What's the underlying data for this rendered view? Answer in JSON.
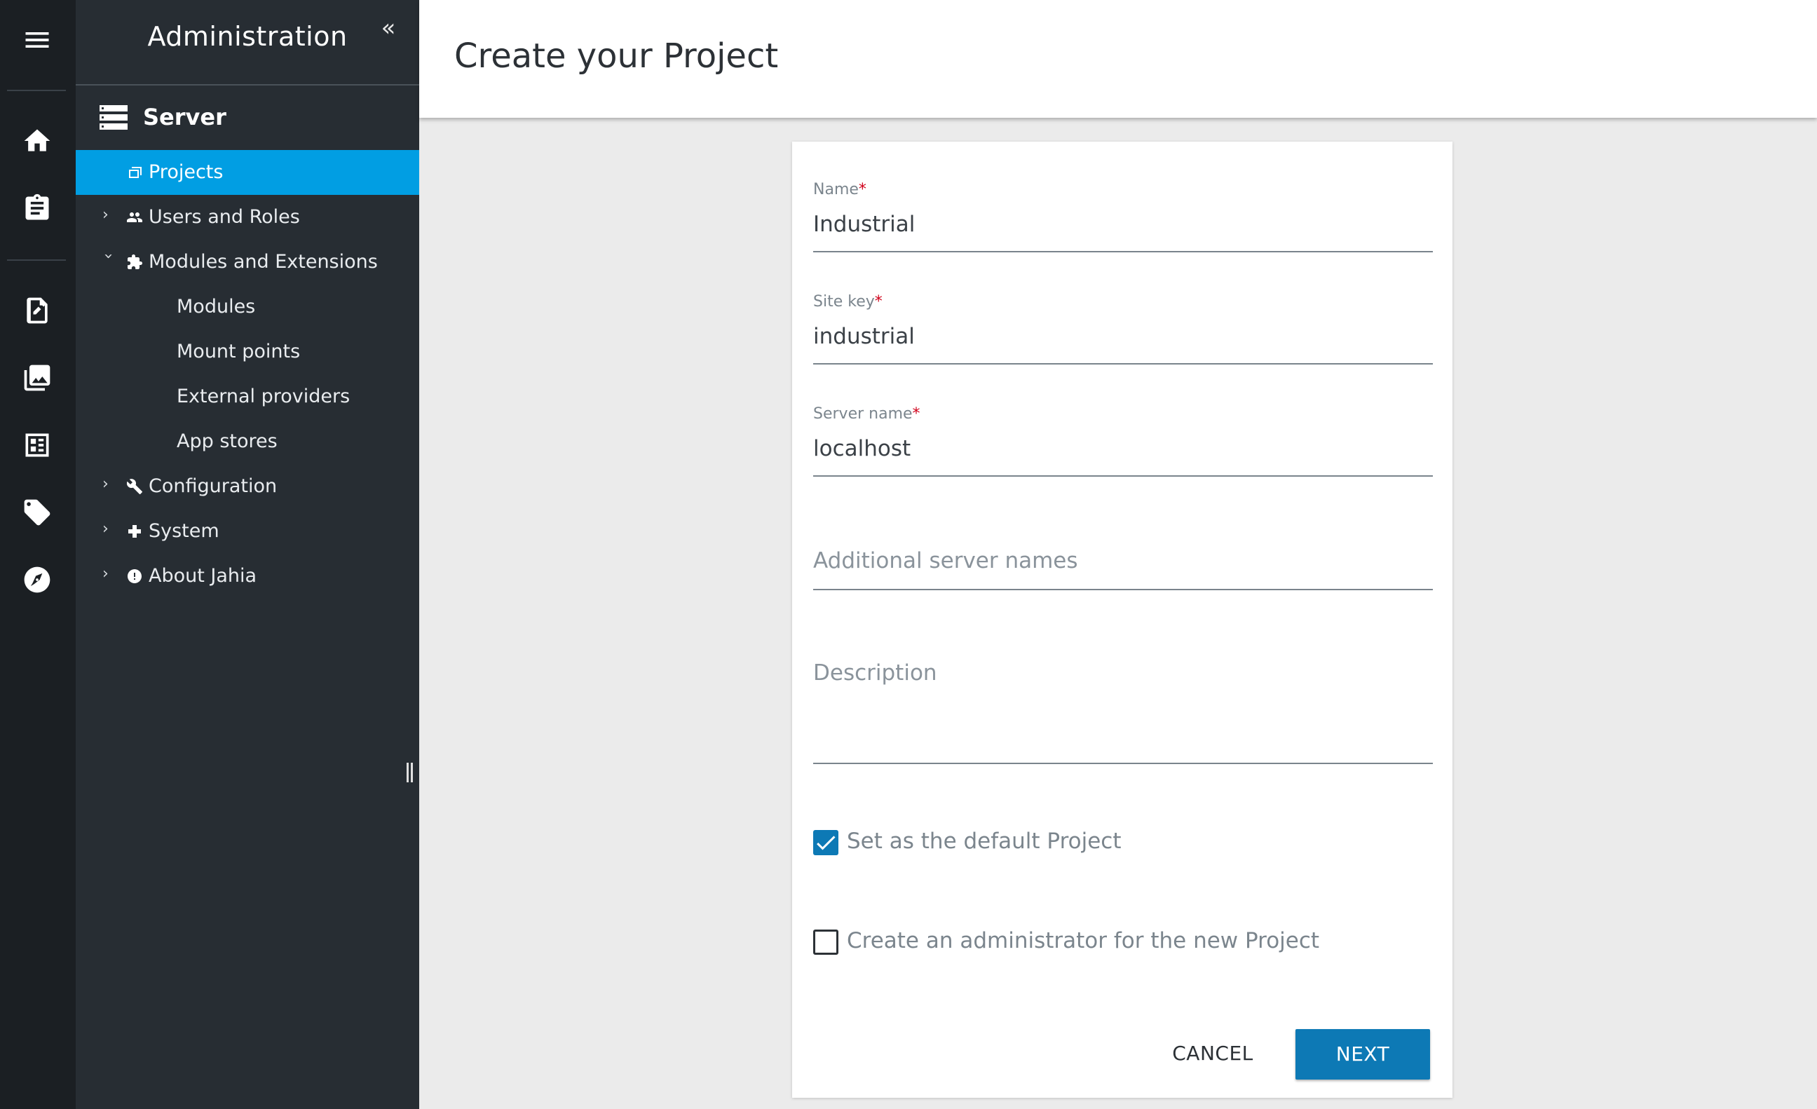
{
  "sidebar": {
    "title": "Administration",
    "collapse_icon": "«",
    "section": "Server",
    "items": [
      {
        "label": "Projects",
        "icon": "projects-icon"
      },
      {
        "label": "Users and Roles",
        "icon": "users-icon"
      },
      {
        "label": "Modules and Extensions",
        "icon": "puzzle-icon"
      },
      {
        "label": "Modules"
      },
      {
        "label": "Mount points"
      },
      {
        "label": "External providers"
      },
      {
        "label": "App stores"
      },
      {
        "label": "Configuration",
        "icon": "wrench-icon"
      },
      {
        "label": "System",
        "icon": "plus-icon"
      },
      {
        "label": "About Jahia",
        "icon": "info-icon"
      }
    ]
  },
  "rail": {
    "icons": [
      "menu-icon",
      "home-icon",
      "clipboard-icon",
      "content-editor-icon",
      "images-icon",
      "dashboard-icon",
      "tag-icon",
      "compass-icon"
    ]
  },
  "header": {
    "title": "Create your Project"
  },
  "form": {
    "name": {
      "label": "Name",
      "required": "*",
      "value": "Industrial"
    },
    "site_key": {
      "label": "Site key",
      "required": "*",
      "value": "industrial"
    },
    "server_name": {
      "label": "Server name",
      "required": "*",
      "value": "localhost"
    },
    "additional_server_names": {
      "placeholder": "Additional server names"
    },
    "description": {
      "placeholder": "Description"
    },
    "default_project": {
      "label": "Set as the default Project",
      "checked": true
    },
    "create_admin": {
      "label": "Create an administrator for the new Project",
      "checked": false
    },
    "cancel_label": "CANCEL",
    "next_label": "NEXT"
  },
  "colors": {
    "accent": "#019ee3",
    "primary_button": "#0d79b5",
    "rail_bg": "#1b1f23",
    "nav_bg": "#272d33",
    "required": "#d0021b"
  }
}
